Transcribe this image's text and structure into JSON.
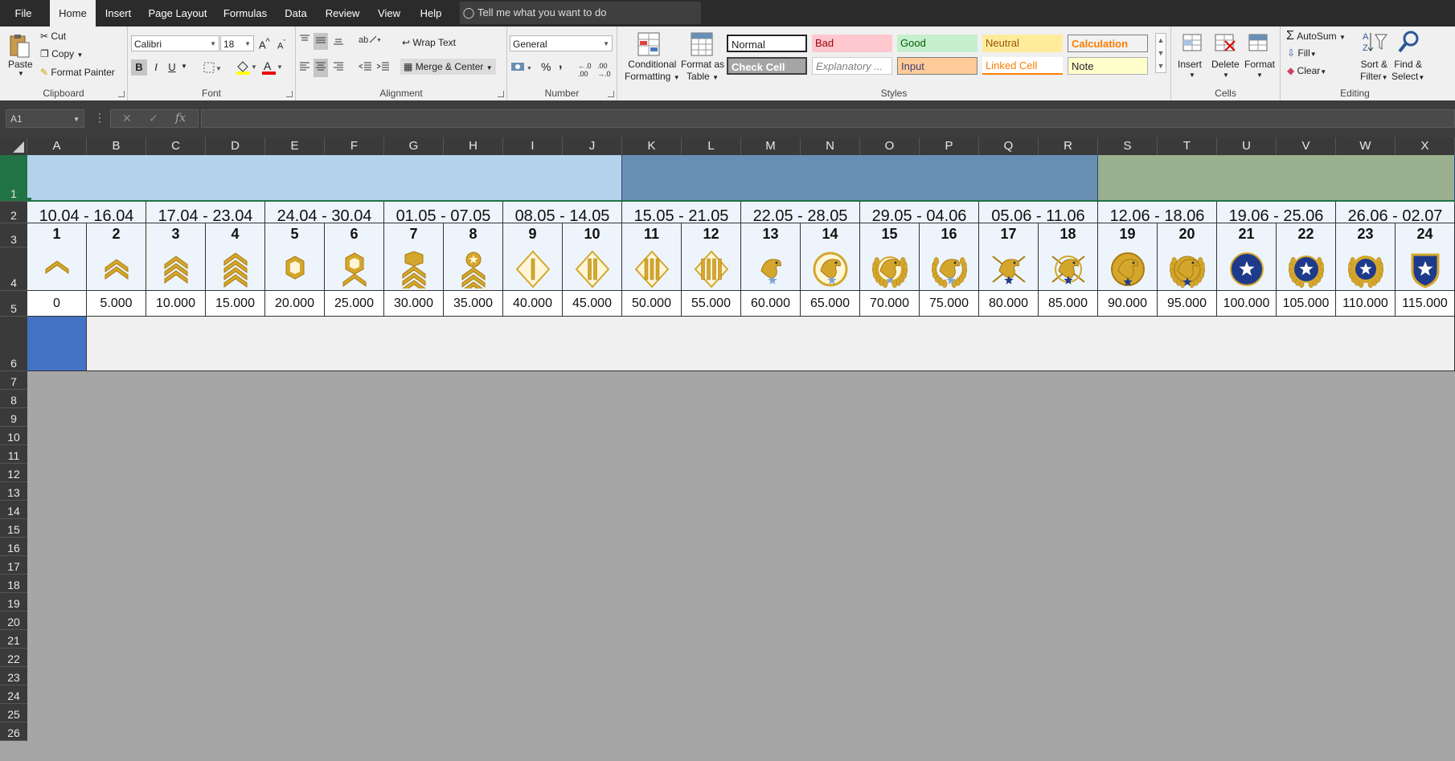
{
  "menu": {
    "file": "File",
    "tabs": [
      "Home",
      "Insert",
      "Page Layout",
      "Formulas",
      "Data",
      "Review",
      "View",
      "Help"
    ],
    "tell_me": "Tell me what you want to do"
  },
  "ribbon": {
    "clipboard": {
      "paste": "Paste",
      "cut": "Cut",
      "copy": "Copy",
      "format_painter": "Format Painter",
      "label": "Clipboard"
    },
    "font": {
      "family": "Calibri",
      "size": "18",
      "bold": "B",
      "italic": "I",
      "underline": "U",
      "label": "Font"
    },
    "alignment": {
      "wrap_text": "Wrap Text",
      "merge_center": "Merge & Center",
      "label": "Alignment"
    },
    "number": {
      "format": "General",
      "percent": "%",
      "comma": ",",
      "label": "Number"
    },
    "styles": {
      "conditional_formatting": [
        "Conditional",
        "Formatting"
      ],
      "format_as_table": [
        "Format as",
        "Table"
      ],
      "cells": [
        "Normal",
        "Bad",
        "Good",
        "Neutral",
        "Calculation",
        "Check Cell",
        "Explanatory ...",
        "Input",
        "Linked Cell",
        "Note"
      ],
      "label": "Styles"
    },
    "cells": {
      "insert": "Insert",
      "delete": "Delete",
      "format": "Format",
      "label": "Cells"
    },
    "editing": {
      "autosum": "AutoSum",
      "fill": "Fill",
      "clear": "Clear",
      "sort_filter": [
        "Sort &",
        "Filter"
      ],
      "find_select": [
        "Find &",
        "Select"
      ],
      "label": "Editing"
    }
  },
  "formula_bar": {
    "name_box": "A1",
    "fx": "fx",
    "formula": ""
  },
  "columns": [
    "A",
    "B",
    "C",
    "D",
    "E",
    "F",
    "G",
    "H",
    "I",
    "J",
    "K",
    "L",
    "M",
    "N",
    "O",
    "P",
    "Q",
    "R",
    "S",
    "T",
    "U",
    "V",
    "W",
    "X"
  ],
  "rows": [
    "1",
    "2",
    "3",
    "4",
    "5",
    "6",
    "7",
    "8",
    "9",
    "10",
    "11",
    "12",
    "13",
    "14",
    "15",
    "16",
    "17",
    "18",
    "19",
    "20",
    "21",
    "22",
    "23",
    "24",
    "25",
    "26"
  ],
  "sheet": {
    "row1_bands": [
      {
        "color": "#b4d2ec"
      },
      {
        "color": "#6a8fb4"
      },
      {
        "color": "#9bb08e"
      }
    ],
    "date_ranges": [
      "10.04 - 16.04",
      "17.04 - 23.04",
      "24.04 - 30.04",
      "01.05 - 07.05",
      "08.05 - 14.05",
      "15.05 - 21.05",
      "22.05 - 28.05",
      "29.05 - 04.06",
      "05.06 - 11.06",
      "12.06 - 18.06",
      "19.06 - 25.06",
      "26.06 - 02.07"
    ],
    "ranks": [
      "1",
      "2",
      "3",
      "4",
      "5",
      "6",
      "7",
      "8",
      "9",
      "10",
      "11",
      "12",
      "13",
      "14",
      "15",
      "16",
      "17",
      "18",
      "19",
      "20",
      "21",
      "22",
      "23",
      "24"
    ],
    "points": [
      "0",
      "5.000",
      "10.000",
      "15.000",
      "20.000",
      "25.000",
      "30.000",
      "35.000",
      "40.000",
      "45.000",
      "50.000",
      "55.000",
      "60.000",
      "65.000",
      "70.000",
      "75.000",
      "80.000",
      "85.000",
      "90.000",
      "95.000",
      "100.000",
      "105.000",
      "110.000",
      "115.000"
    ],
    "rank_icons": [
      "chevron-1-icon",
      "chevron-2-icon",
      "chevron-3-icon",
      "chevron-4-icon",
      "ring-icon",
      "ring-chevron-icon",
      "ring-chevron-2-icon",
      "star-chevron-icon",
      "diamond-1-bar-icon",
      "diamond-2-bar-icon",
      "diamond-3-bar-icon",
      "diamond-4-bar-icon",
      "eagle-star-icon",
      "eagle-ring-icon",
      "eagle-wreath-icon",
      "eagle-wreath-star-icon",
      "eagle-arrows-icon",
      "eagle-arrows-ring-icon",
      "gold-seal-star-icon",
      "gold-seal-wreath-icon",
      "blue-star-medal-icon",
      "blue-star-wreath-icon",
      "blue-star-laurel-icon",
      "blue-shield-star-icon"
    ]
  },
  "colors": {
    "gold": "#d4a72c",
    "gold_dark": "#a87a12",
    "blue_star": "#1e3a8a",
    "selected_cell": "#4472c4",
    "excel_green": "#217346"
  }
}
